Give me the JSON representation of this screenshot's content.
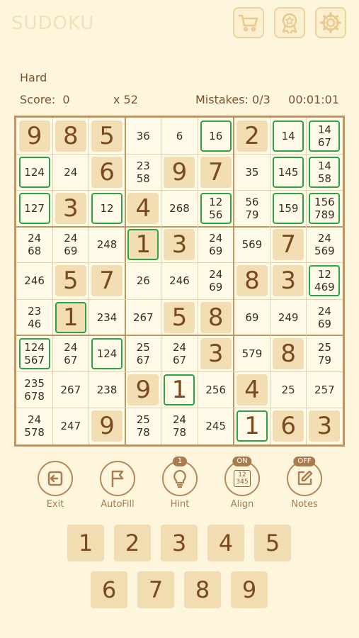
{
  "header": {
    "title": "SUDOKU"
  },
  "top_icons": [
    "cart-icon",
    "award-icon",
    "gear-icon"
  ],
  "difficulty": "Hard",
  "status": {
    "score_label": "Score:",
    "score_value": "0",
    "multiplier": "x 52",
    "mistakes_label": "Mistakes:",
    "mistakes_value": "0/3",
    "timer": "00:01:01"
  },
  "board": {
    "rows": [
      [
        "G9",
        "G8",
        "G5",
        "36",
        "6",
        "16",
        "G2",
        "14",
        "14\n67"
      ],
      [
        "124",
        "24",
        "G6",
        "23\n58",
        "G9",
        "G7",
        "35",
        "145",
        "14\n58"
      ],
      [
        "127",
        "G3",
        "12",
        "G4",
        "268",
        "12\n56",
        "56\n79",
        "159",
        "156\n789"
      ],
      [
        "24\n68",
        "24\n69",
        "248",
        "G1",
        "G3",
        "24\n69",
        "569",
        "G7",
        "24\n569"
      ],
      [
        "246",
        "G5",
        "G7",
        "26",
        "246",
        "24\n69",
        "G8",
        "G3",
        "12\n469"
      ],
      [
        "23\n46",
        "G1",
        "234",
        "267",
        "G5",
        "G8",
        "69",
        "249",
        "24\n69"
      ],
      [
        "124\n567",
        "24\n67",
        "124",
        "25\n67",
        "24\n67",
        "G3",
        "579",
        "G8",
        "25\n79"
      ],
      [
        "235\n678",
        "267",
        "238",
        "G9",
        "S1",
        "256",
        "G4",
        "25",
        "257"
      ],
      [
        "24\n578",
        "247",
        "G9",
        "25\n78",
        "24\n78",
        "245",
        "S1",
        "G6",
        "G3"
      ]
    ],
    "highlighted": [
      [
        0,
        5
      ],
      [
        0,
        7
      ],
      [
        0,
        8
      ],
      [
        1,
        0
      ],
      [
        1,
        7
      ],
      [
        1,
        8
      ],
      [
        2,
        0
      ],
      [
        2,
        2
      ],
      [
        2,
        5
      ],
      [
        2,
        7
      ],
      [
        2,
        8
      ],
      [
        3,
        3
      ],
      [
        4,
        8
      ],
      [
        5,
        1
      ],
      [
        6,
        0
      ],
      [
        6,
        2
      ],
      [
        7,
        4
      ],
      [
        8,
        6
      ]
    ],
    "colors": {
      "given_bg": "#f3deb3",
      "highlight": "#2aa444",
      "major_line": "#bf9560",
      "minor_line": "#e6d3ad"
    }
  },
  "toolbar": {
    "exit": "Exit",
    "autofill": "AutoFill",
    "hint": "Hint",
    "hint_badge": "1",
    "align": "Align",
    "align_badge": "ON",
    "align_icon_text": "12\n345",
    "notes": "Notes",
    "notes_badge": "OFF"
  },
  "numpad": [
    "1",
    "2",
    "3",
    "4",
    "5",
    "6",
    "7",
    "8",
    "9"
  ]
}
